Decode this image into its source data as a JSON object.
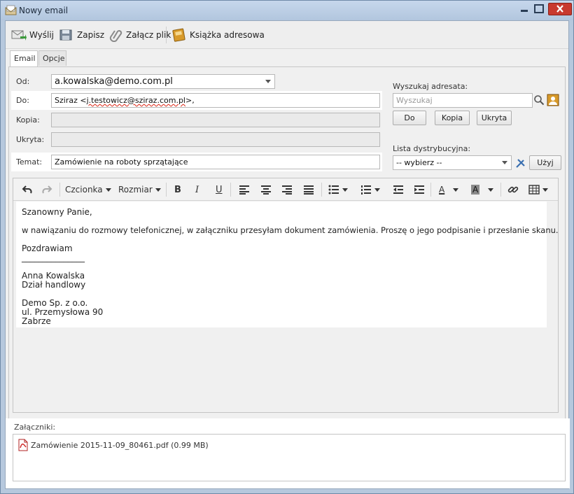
{
  "window": {
    "title": "Nowy email"
  },
  "toolbar": {
    "send_label": "Wyślij",
    "save_label": "Zapisz",
    "attach_label": "Załącz plik",
    "addressbook_label": "Książka adresowa"
  },
  "tabs": [
    {
      "label": "Email"
    },
    {
      "label": "Opcje"
    }
  ],
  "form": {
    "from_label": "Od:",
    "from_value": "a.kowalska@demo.com.pl",
    "to_label": "Do:",
    "to_prefix": "Sziraz <",
    "to_email": "j.testowicz@sziraz.com.pl",
    "to_suffix": ">,",
    "cc_label": "Kopia:",
    "cc_value": "",
    "bcc_label": "Ukryta:",
    "bcc_value": "",
    "subject_label": "Temat:",
    "subject_value": "Zamówienie na roboty sprzątające"
  },
  "search": {
    "label": "Wyszukaj adresata:",
    "placeholder": "Wyszukaj",
    "to_button": "Do",
    "cc_button": "Kopia",
    "bcc_button": "Ukryta"
  },
  "distribution": {
    "label": "Lista dystrybucyjna:",
    "selected": "-- wybierz --",
    "use_button": "Użyj"
  },
  "editor_toolbar": {
    "font_label": "Czcionka",
    "size_label": "Rozmiar",
    "bold": "B",
    "italic": "I",
    "underline": "U",
    "text_color": "A",
    "bg_color": "A"
  },
  "body": {
    "greeting": "Szanowny Panie,",
    "paragraph": "w nawiązaniu do rozmowy telefonicznej, w załączniku przesyłam dokument zamówienia. Proszę o jego podpisanie i przesłanie skanu.",
    "closing": "Pozdrawiam",
    "separator": "_______________",
    "name": "Anna Kowalska",
    "department": "Dział handlowy",
    "company": "Demo Sp. z o.o.",
    "street": "ul. Przemysłowa 90",
    "city": "Zabrze"
  },
  "attachments": {
    "label": "Załączniki:",
    "items": [
      {
        "name": "Zamówienie 2015-11-09_80461.pdf (0.99 MB)"
      }
    ]
  },
  "colors": {
    "accent": "#c8392f",
    "window_frame": "#b6c8dd"
  }
}
